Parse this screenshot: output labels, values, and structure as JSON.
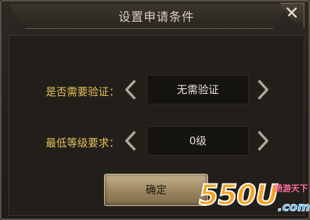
{
  "dialog": {
    "title": "设置申请条件",
    "rows": [
      {
        "label": "是否需要验证：",
        "value": "无需验证"
      },
      {
        "label": "最低等级要求：",
        "value": "0级"
      }
    ],
    "confirm_label": "确定"
  },
  "watermark": {
    "logo": "550U",
    "tagline": "畅游天下",
    "domain": ".com"
  },
  "colors": {
    "label": "#e6c15a",
    "value": "#e8e3da",
    "title": "#d9cfbf",
    "button": "#9e8862"
  },
  "icons": [
    "close-icon",
    "arrow-left-icon",
    "arrow-right-icon"
  ]
}
